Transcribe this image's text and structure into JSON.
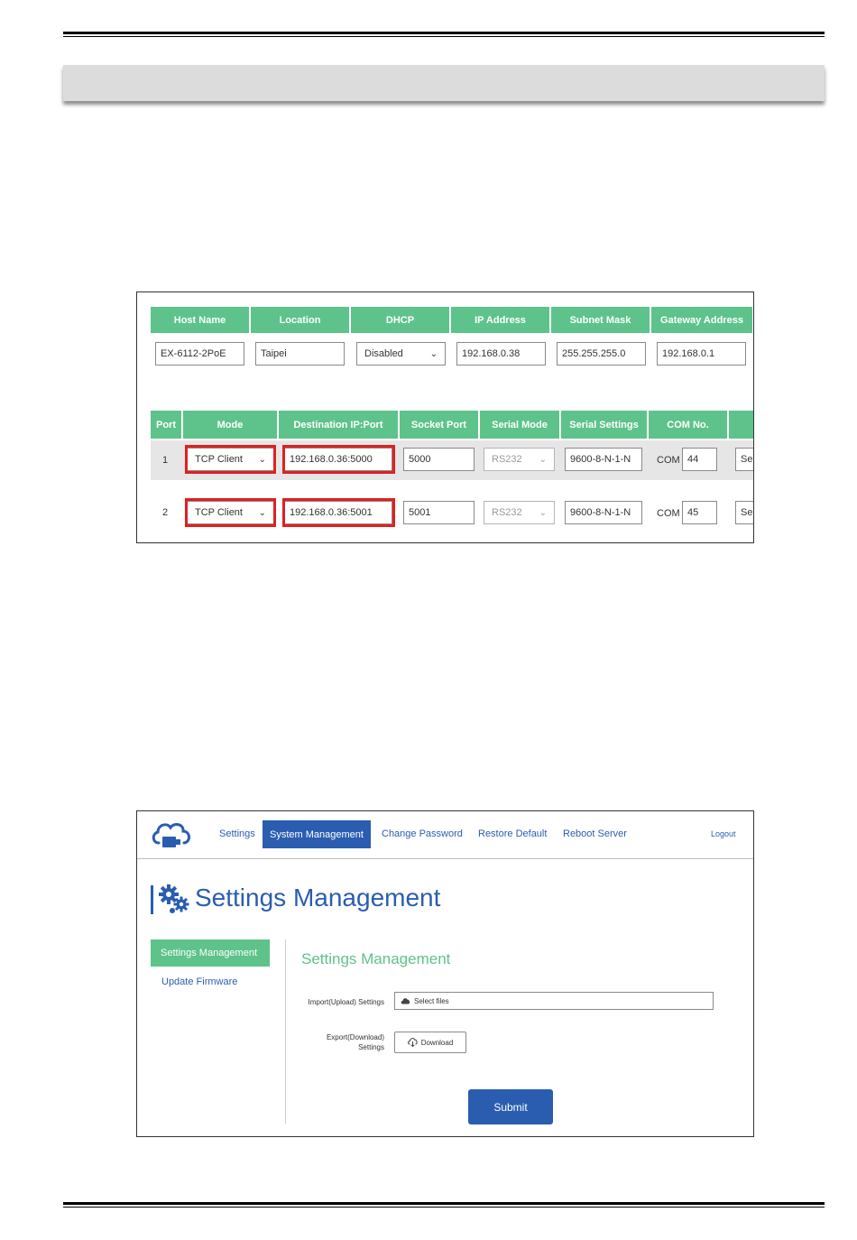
{
  "network_table": {
    "headers": [
      "Host Name",
      "Location",
      "DHCP",
      "IP Address",
      "Subnet Mask",
      "Gateway Address"
    ],
    "host_name": "EX-6112-2PoE",
    "location": "Taipei",
    "dhcp": "Disabled",
    "ip_address": "192.168.0.38",
    "subnet_mask": "255.255.255.0",
    "gateway_address": "192.168.0.1"
  },
  "port_table": {
    "headers": [
      "Port",
      "Mode",
      "Destination IP:Port",
      "Socket Port",
      "Serial Mode",
      "Serial Settings",
      "COM No.",
      ""
    ],
    "com_prefix": "COM",
    "rows": [
      {
        "port": "1",
        "mode": "TCP Client",
        "destination": "192.168.0.36:5000",
        "socket_port": "5000",
        "serial_mode": "RS232",
        "serial_settings": "9600-8-N-1-N",
        "com_no": "44",
        "extra": "Se"
      },
      {
        "port": "2",
        "mode": "TCP Client",
        "destination": "192.168.0.36:5001",
        "socket_port": "5001",
        "serial_mode": "RS232",
        "serial_settings": "9600-8-N-1-N",
        "com_no": "45",
        "extra": "Se"
      }
    ]
  },
  "settings_ui": {
    "nav": {
      "settings": "Settings",
      "system_management": "System Management",
      "change_password": "Change Password",
      "restore_default": "Restore Default",
      "reboot_server": "Reboot Server",
      "logout": "Logout"
    },
    "page_title": "Settings Management",
    "sidebar": {
      "settings_management": "Settings Management",
      "update_firmware": "Update Firmware"
    },
    "section_title": "Settings Management",
    "import_label": "Import(Upload) Settings",
    "select_files": "Select files",
    "export_label_line1": "Export(Download)",
    "export_label_line2": "Settings",
    "download": "Download",
    "submit": "Submit",
    "colors": {
      "blue": "#2a5db0",
      "green": "#5ec38a"
    }
  }
}
